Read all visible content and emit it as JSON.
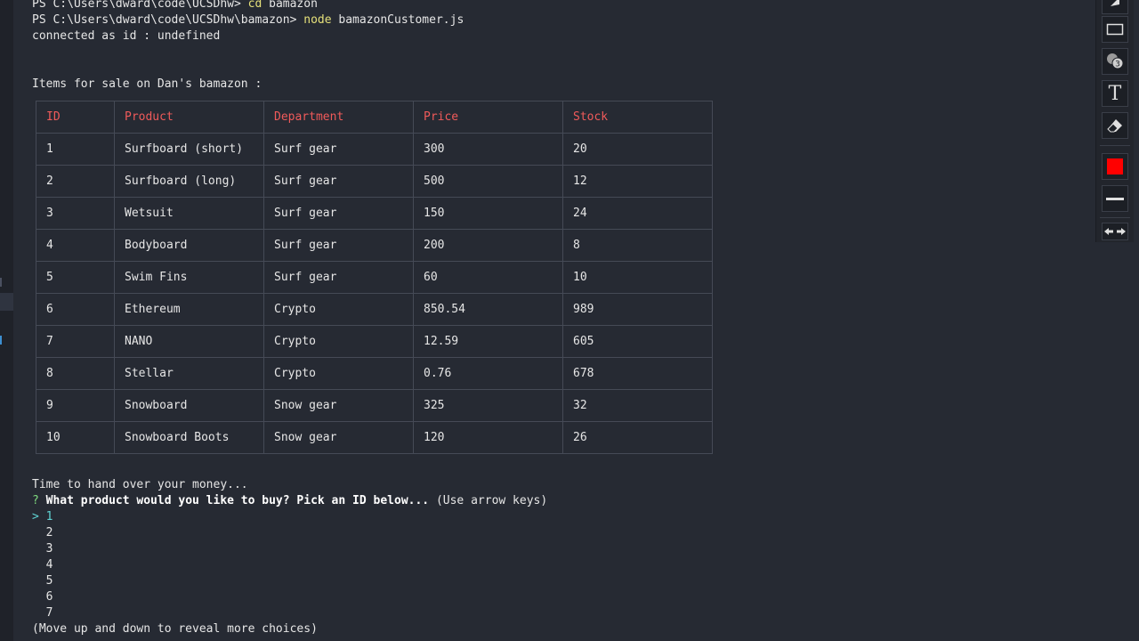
{
  "terminal": {
    "lines": [
      {
        "prefix": "PS C:\\Users\\dward\\code\\UCSDhw> ",
        "cmd": "cd",
        "arg": " bamazon"
      },
      {
        "prefix": "PS C:\\Users\\dward\\code\\UCSDhw\\bamazon> ",
        "cmd": "node",
        "arg": " bamazonCustomer.js"
      }
    ],
    "connected": "connected as id : undefined",
    "items_heading": "Items for sale on Dan's bamazon :",
    "time_line": "Time to hand over your money...",
    "prompt_mark": "?",
    "prompt_question": "What product would you like to buy? Pick an ID below...",
    "prompt_hint": " (Use arrow keys)",
    "pointer": ">",
    "choices": [
      "1",
      "2",
      "3",
      "4",
      "5",
      "6",
      "7"
    ],
    "more_hint": "(Move up and down to reveal more choices)"
  },
  "table": {
    "headers": [
      "ID",
      "Product",
      "Department",
      "Price",
      "Stock"
    ],
    "rows": [
      [
        "1",
        "Surfboard (short)",
        "Surf gear",
        "300",
        "20"
      ],
      [
        "2",
        "Surfboard (long)",
        "Surf gear",
        "500",
        "12"
      ],
      [
        "3",
        "Wetsuit",
        "Surf gear",
        "150",
        "24"
      ],
      [
        "4",
        "Bodyboard",
        "Surf gear",
        "200",
        "8"
      ],
      [
        "5",
        "Swim Fins",
        "Surf gear",
        "60",
        "10"
      ],
      [
        "6",
        "Ethereum",
        "Crypto",
        "850.54",
        "989"
      ],
      [
        "7",
        "NANO",
        "Crypto",
        "12.59",
        "605"
      ],
      [
        "8",
        "Stellar",
        "Crypto",
        "0.76",
        "678"
      ],
      [
        "9",
        "Snowboard",
        "Snow gear",
        "325",
        "32"
      ],
      [
        "10",
        "Snowboard Boots",
        "Snow gear",
        "120",
        "26"
      ]
    ]
  },
  "toolbar": {
    "tools": [
      {
        "icon": "arrow-cursor-icon"
      },
      {
        "icon": "rectangle-icon"
      },
      {
        "icon": "counter-stamp-icon"
      },
      {
        "icon": "text-tool-icon",
        "glyph": "T"
      },
      {
        "icon": "eraser-icon"
      },
      {
        "icon": "color-swatch-icon",
        "color": "#ff0000"
      },
      {
        "icon": "line-width-icon"
      },
      {
        "icon": "undo-redo-icon"
      }
    ]
  },
  "colors": {
    "background": "#262a33",
    "table_header": "#f05a5a",
    "command": "#e5e07a",
    "prompt_mark": "#7fd97f",
    "selected": "#5fd3d3"
  }
}
